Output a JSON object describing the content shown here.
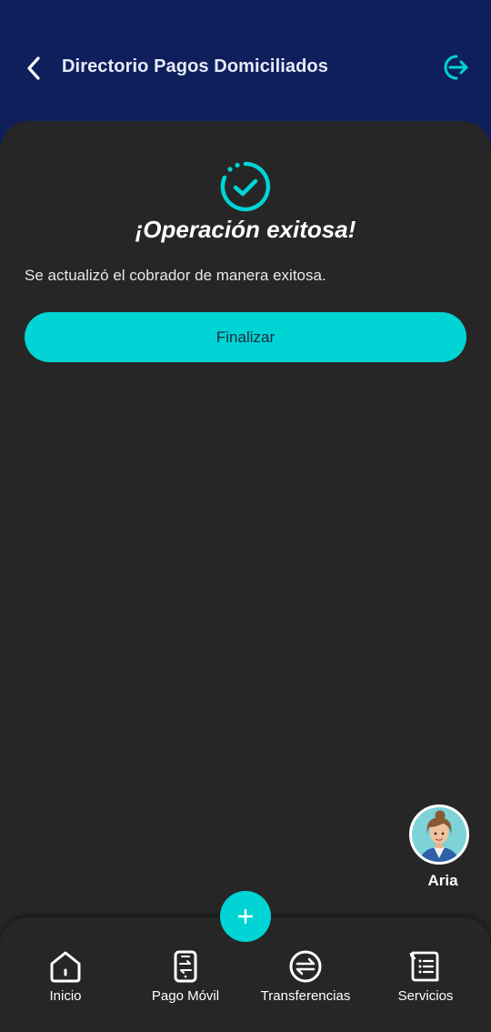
{
  "header": {
    "title": "Directorio Pagos Domiciliados",
    "back_icon": "chevron-left-icon",
    "logout_icon": "logout-icon"
  },
  "main": {
    "success_title": "¡Operación exitosa!",
    "message": "Se actualizó el cobrador de manera exitosa.",
    "finalize_label": "Finalizar",
    "success_icon": "check-circle-icon"
  },
  "assistant": {
    "name": "Aria"
  },
  "nav": {
    "items": [
      {
        "label": "Inicio",
        "icon": "home-icon"
      },
      {
        "label": "Pago Móvil",
        "icon": "mobile-transfer-icon"
      },
      {
        "label": "Transferencias",
        "icon": "transfer-icon"
      },
      {
        "label": "Servicios",
        "icon": "receipt-icon"
      }
    ],
    "fab_icon": "plus-icon"
  },
  "colors": {
    "header_bg": "#0e1f5c",
    "content_bg": "#262626",
    "accent": "#00d4d4"
  }
}
